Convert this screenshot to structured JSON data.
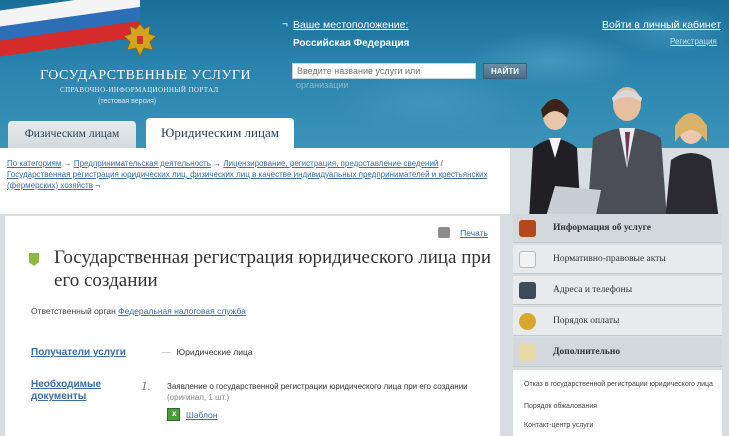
{
  "header": {
    "brand_title": "ГОСУДАРСТВЕННЫЕ УСЛУГИ",
    "brand_subtitle": "СПРАВОЧНО-ИНФОРМАЦИОННЫЙ ПОРТАЛ",
    "brand_test": "(тестовая версия)",
    "location_label": "Ваше местоположение:",
    "location_value": "Российская Федерация",
    "search_placeholder": "Введите название услуги или",
    "search_overflow": "организации",
    "search_button": "НАЙТИ",
    "login_link": "Войти в личный кабинет",
    "register_link": "Регистрация"
  },
  "tabs": {
    "individuals": "Физическим лицам",
    "legal": "Юридическим лицам"
  },
  "breadcrumb": {
    "item1": "По категориям",
    "item2": "Предпринимательская деятельность",
    "item3": "Лицензирование, регистрация, предоставление сведений",
    "item4": "Государственная регистрация юридических лиц, физических лиц в качестве индивидуальных предпринимателей и крестьянских (фермерских) хозяйств"
  },
  "main": {
    "print_label": "Печать",
    "title": "Государственная регистрация юридического лица при его создании",
    "responsible_label": "Ответственный орган",
    "responsible_value": "Федеральная налоговая служба",
    "recipients_label": "Получатели услуги",
    "recipients_value": "Юридические лица",
    "documents_label": "Необходимые документы",
    "doc1_number": "1.",
    "doc1_text": "Заявление о государственной регистрации юридического лица при его создании",
    "doc1_note": "(оригинал, 1 шт.)",
    "template_link": "Шаблон"
  },
  "sidebar": {
    "items": [
      {
        "label": "Информация об услуге",
        "icon": "briefcase-icon",
        "color": "#b5471c"
      },
      {
        "label": "Нормативно-правовые акты",
        "icon": "document-icon",
        "color": "#f2f2f2"
      },
      {
        "label": "Адреса и телефоны",
        "icon": "phone-icon",
        "color": "#3e4a55"
      },
      {
        "label": "Порядок оплаты",
        "icon": "coins-icon",
        "color": "#d9a72b"
      },
      {
        "label": "Дополнительно",
        "icon": "notes-icon",
        "color": "#e7d9a6"
      }
    ],
    "subitems": [
      "Отказ в государственной регистрации юридического лица",
      "Порядок обжалования",
      "Контакт-центр услуги"
    ]
  },
  "colors": {
    "link": "#3a6ea5",
    "header_blue": "#2a84ad",
    "accent_green": "#8dbb39"
  }
}
